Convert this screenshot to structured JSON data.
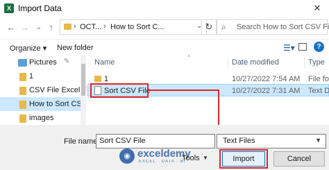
{
  "window": {
    "title": "Import Data",
    "app_icon_letter": "X"
  },
  "nav": {
    "back": "←",
    "forward": "→",
    "recent": "⌄",
    "up": "↑",
    "address": {
      "crumb1": "OCT...",
      "separator": "›",
      "crumb2": "How to Sort C...",
      "dropdown": "⌄"
    },
    "refresh": "↻",
    "search": {
      "placeholder": "Search How to Sort CSV File ..."
    }
  },
  "toolbar": {
    "organize": "Organize ▾",
    "new_folder": "New folder"
  },
  "sidebar": {
    "items": [
      {
        "label": "Pictures",
        "pinned": "✎"
      },
      {
        "label": "1"
      },
      {
        "label": "CSV File Excel F"
      },
      {
        "label": "How to Sort CS"
      },
      {
        "label": "images"
      }
    ]
  },
  "filelist": {
    "columns": {
      "name": "Name",
      "date": "Date modified",
      "type": "Type"
    },
    "rows": [
      {
        "name": "1",
        "date": "10/27/2022 7:54 AM",
        "type": "File fol"
      },
      {
        "name": "Sort CSV File",
        "date": "10/27/2022 7:31 AM",
        "type": "Text Do"
      }
    ]
  },
  "footer": {
    "file_name_label": "File name:",
    "file_name_value": "Sort CSV File",
    "file_type_value": "Text Files",
    "tools": "Tools",
    "import": "Import",
    "cancel": "Cancel"
  },
  "watermark": {
    "brand": "exceldemy",
    "tagline": "EXCEL · DATA · BI"
  },
  "colors": {
    "highlight": "#e0262c",
    "selection": "#cce8ff",
    "folder": "#e8b84a",
    "accent": "#0078d7"
  }
}
